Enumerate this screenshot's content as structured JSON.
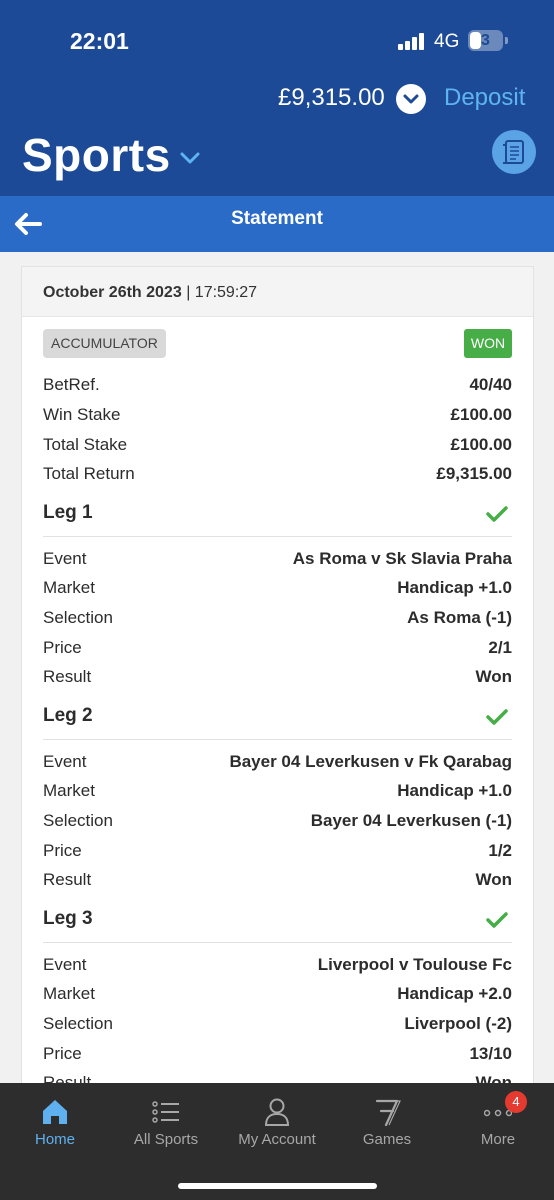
{
  "status_bar": {
    "time": "22:01",
    "network": "4G",
    "battery": "3"
  },
  "header": {
    "balance": "£9,315.00",
    "deposit_label": "Deposit",
    "title": "Sports"
  },
  "subheader": {
    "title": "Statement"
  },
  "bet": {
    "date": "October 26th 2023",
    "time_text": "| 17:59:27",
    "type": "ACCUMULATOR",
    "status": "WON",
    "summary": [
      {
        "label": "BetRef.",
        "value": "40/40"
      },
      {
        "label": "Win Stake",
        "value": "£100.00"
      },
      {
        "label": "Total Stake",
        "value": "£100.00"
      },
      {
        "label": "Total Return",
        "value": "£9,315.00"
      }
    ],
    "legs": [
      {
        "title": "Leg 1",
        "rows": [
          {
            "label": "Event",
            "value": "As Roma v Sk Slavia Praha"
          },
          {
            "label": "Market",
            "value": "Handicap +1.0"
          },
          {
            "label": "Selection",
            "value": "As Roma (-1)"
          },
          {
            "label": "Price",
            "value": "2/1"
          },
          {
            "label": "Result",
            "value": "Won"
          }
        ]
      },
      {
        "title": "Leg 2",
        "rows": [
          {
            "label": "Event",
            "value": "Bayer 04 Leverkusen v Fk Qarabag"
          },
          {
            "label": "Market",
            "value": "Handicap +1.0"
          },
          {
            "label": "Selection",
            "value": "Bayer 04 Leverkusen (-1)"
          },
          {
            "label": "Price",
            "value": "1/2"
          },
          {
            "label": "Result",
            "value": "Won"
          }
        ]
      },
      {
        "title": "Leg 3",
        "rows": [
          {
            "label": "Event",
            "value": "Liverpool v Toulouse Fc"
          },
          {
            "label": "Market",
            "value": "Handicap +2.0"
          },
          {
            "label": "Selection",
            "value": "Liverpool (-2)"
          },
          {
            "label": "Price",
            "value": "13/10"
          },
          {
            "label": "Result",
            "value": "Won"
          }
        ]
      }
    ]
  },
  "nav": {
    "items": [
      {
        "label": "Home",
        "icon": "home-icon"
      },
      {
        "label": "All Sports",
        "icon": "list-icon"
      },
      {
        "label": "My Account",
        "icon": "person-icon"
      },
      {
        "label": "Games",
        "icon": "slot-seven-icon"
      },
      {
        "label": "More",
        "icon": "more-dots-icon",
        "badge": "4"
      }
    ]
  },
  "colors": {
    "header_blue": "#1c4a96",
    "statement_bar_blue": "#2a6bc8",
    "accent_light_blue": "#5eb4ef",
    "won_green": "#46ad47",
    "nav_background": "#2d2d2d"
  }
}
